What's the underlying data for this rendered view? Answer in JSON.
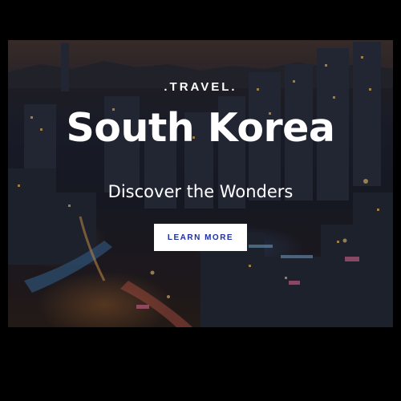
{
  "hero": {
    "eyebrow": ".TRAVEL.",
    "title": "South Korea",
    "subtitle": "Discover the Wonders",
    "cta_label": "LEARN MORE"
  },
  "colors": {
    "page_background": "#000000",
    "text": "#ffffff",
    "button_background": "#ffffff",
    "button_text": "#1e2fa8"
  }
}
